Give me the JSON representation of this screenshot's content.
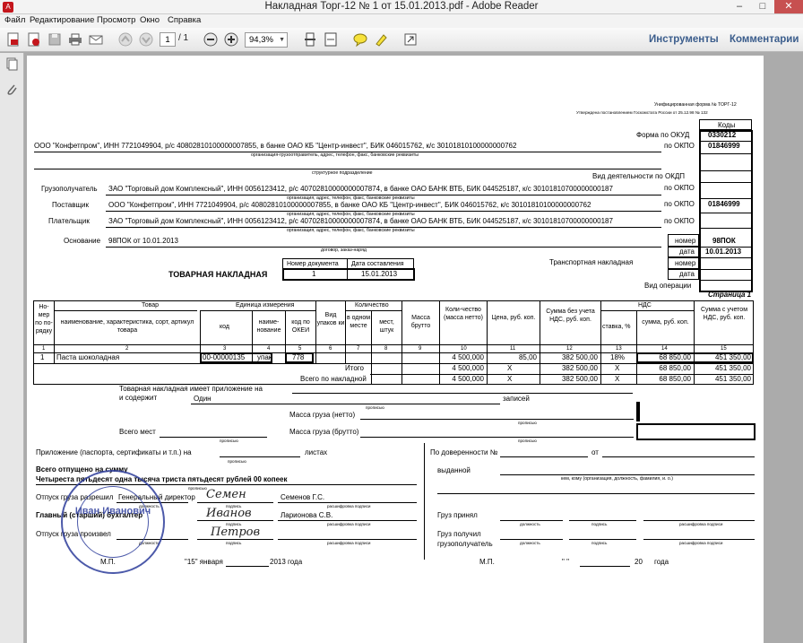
{
  "window": {
    "title": "Накладная Торг-12 № 1 от 15.01.2013.pdf - Adobe Reader",
    "minimize": "–",
    "maximize": "□",
    "close": "✕"
  },
  "menu": [
    "Файл",
    "Редактирование",
    "Просмотр",
    "Окно",
    "Справка"
  ],
  "toolbar": {
    "page_current": "1",
    "page_total": "/ 1",
    "zoom": "94,3%",
    "tools": "Инструменты",
    "comments": "Комментарии",
    "icons": [
      "create-pdf-icon",
      "export-icon",
      "save-icon",
      "print-icon",
      "email-icon",
      "page-up-icon",
      "page-down-icon",
      "zoom-out-icon",
      "zoom-in-icon",
      "fit-page-icon",
      "fit-width-icon",
      "comment-icon",
      "highlight-icon",
      "fullscreen-icon"
    ]
  },
  "sidebar": {
    "icons": [
      "pages-icon",
      "attachments-icon"
    ]
  },
  "doc": {
    "form_note1": "Унифицированная форма № ТОРГ-12",
    "form_note2": "Утверждена постановлением Госкомстата России от 25.12.98 № 132",
    "codes_header": "Коды",
    "okud_label": "Форма по ОКУД",
    "okud_code": "0330212",
    "okpo_label": "по ОКПО",
    "okpo1": "01846999",
    "okpo3": "01846999",
    "okdp_label": "Вид деятельности по ОКДП",
    "shipper_org": "ООО \"Конфетпром\", ИНН 7721049904, р/с 40802810100000007855, в банке ОАО КБ \"Центр-инвест\", БИК 046015762, к/с 30101810100000000762",
    "shipper_caption": "организация-грузоотправитель, адрес, телефон, факс, банковские реквизиты",
    "struct_caption": "структурное подразделение",
    "consignee_label": "Грузополучатель",
    "consignee_text": "ЗАО \"Торговый дом Комплексный\", ИНН 0056123412, р/с 40702810000000007874, в банке ОАО БАНК ВТБ, БИК 044525187, к/с 30101810700000000187",
    "org_caption": "организация, адрес, телефон, факс, банковские реквизиты",
    "supplier_label": "Поставщик",
    "supplier_text": "ООО \"Конфетпром\", ИНН 7721049904, р/с 40802810100000007855, в банке ОАО КБ \"Центр-инвест\", БИК 046015762, к/с 30101810100000000762",
    "payer_label": "Плательщик",
    "payer_text": "ЗАО \"Торговый дом Комплексный\", ИНН 0056123412, р/с 40702810000000007874, в банке ОАО БАНК ВТБ, БИК 044525187, к/с 30101810700000000187",
    "basis_label": "Основание",
    "basis_text": "98ПОК от 10.01.2013",
    "basis_caption": "договор, заказ-наряд",
    "nomer_label": "номер",
    "nomer_value": "98ПОК",
    "data_label": "дата",
    "data_value": "10.01.2013",
    "transport_label": "Транспортная накладная",
    "vid_oper": "Вид операции",
    "doc_num_header": "Номер документа",
    "doc_date_header": "Дата составления",
    "doc_title": "ТОВАРНАЯ НАКЛАДНАЯ",
    "doc_number": "1",
    "doc_date": "15.01.2013",
    "page_label": "Страница 1",
    "h": {
      "num": "Но-мер по по-рядку",
      "tovar": "Товар",
      "tovar_name": "наименование, характеристика, сорт, артикул товара",
      "kod": "код",
      "ed": "Единица измерения",
      "ed_name": "наиме-нование",
      "ed_okei": "код по ОКЕИ",
      "vid": "Вид упаков ки",
      "kolvo": "Количество",
      "v_odnom": "в одном месте",
      "mest": "мест, штук",
      "massa": "Масса брутто",
      "netto": "Коли-чество (масса нетто)",
      "price": "Цена, руб. коп.",
      "sum_no_nds": "Сумма без учета НДС, руб. коп.",
      "nds": "НДС",
      "stavka": "ставка, %",
      "nds_sum": "сумма, руб. коп.",
      "sum_nds": "Сумма с учетом НДС, руб. коп."
    },
    "colnums": [
      "1",
      "2",
      "3",
      "4",
      "5",
      "6",
      "7",
      "8",
      "9",
      "10",
      "11",
      "12",
      "13",
      "14",
      "15"
    ],
    "row": {
      "n": "1",
      "name": "Паста шоколадная",
      "kod": "00-00000135",
      "unit": "упак",
      "okei": "778",
      "netto": "4 500,000",
      "price": "85,00",
      "sum": "382 500,00",
      "rate": "18%",
      "nds": "68 850,00",
      "total": "451 350,00"
    },
    "itogo_label": "Итого",
    "vsego_label": "Всего по накладной",
    "x": "X",
    "prilozh1": "Товарная накладная имеет приложение на",
    "prilozh2": "и содержит",
    "odin": "Один",
    "zapisey": "записей",
    "propis": "прописью",
    "massa_netto": "Масса груза (нетто)",
    "massa_brutto": "Масса груза (брутто)",
    "vsego_mest": "Всего мест",
    "prilozh_pasp": "Приложение (паспорта, сертификаты и т.п.) на",
    "listah": "листах",
    "otpusheno": "Всего отпущено  на сумму",
    "sum_words": "Четыреста пятьдесят одна тысяча триста пятьдесят рублей 00 копеек",
    "otpusk_razr": "Отпуск груза разрешил",
    "director": "Генеральный директор",
    "semenov": "Семенов Г.С.",
    "glav_buh": "Главный (старший) бухгалтер",
    "larionova": "Ларионова С.В.",
    "otpusk_proizv": "Отпуск груза произвел",
    "dolzh": "должность",
    "podpis": "подпись",
    "rassh": "расшифровка подписи",
    "mp": "М.П.",
    "date_left": "\"15\"  января",
    "year_left": "2013 года",
    "doverennost": "По доверенности №",
    "ot": "от",
    "vydannoy": "выданной",
    "kem_caption": "кем, кому (организация, должность, фамилия, и. о.)",
    "gruz_prinyal": "Груз принял",
    "gruz_poluchil": "Груз получил",
    "gruzopoluch": "грузополучатель",
    "date_right": "\"      \"",
    "year_right": "20",
    "goda": "года",
    "stamp": "Иван Иванович",
    "sig1": "Семен",
    "sig2": "Иванов",
    "sig3": "Петров"
  }
}
